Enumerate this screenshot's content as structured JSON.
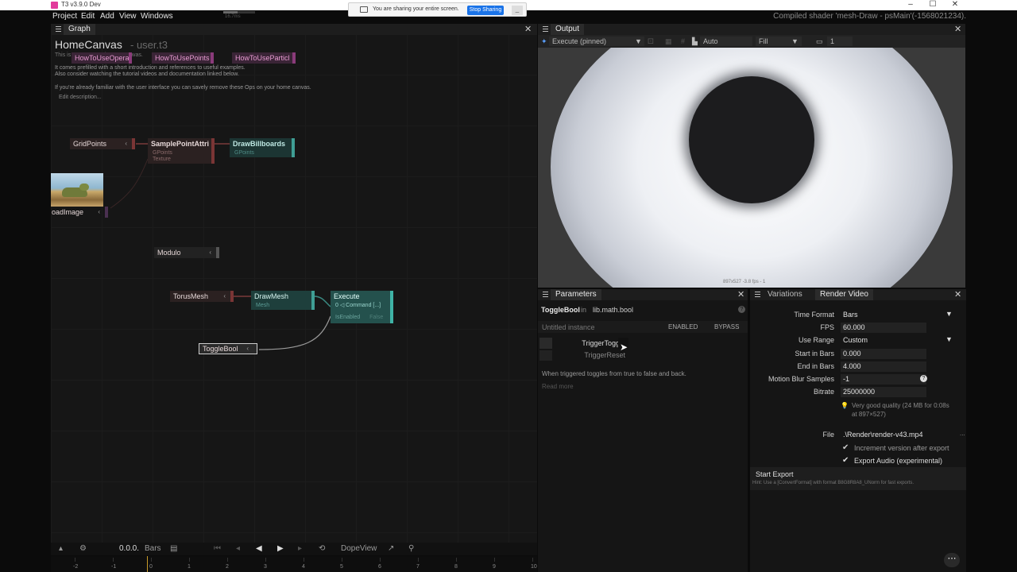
{
  "window": {
    "title": "T3 v3.9.0 Dev",
    "controls": [
      "–",
      "☐",
      "✕"
    ]
  },
  "menu": {
    "items": [
      "Project",
      "Edit",
      "Add",
      "View",
      "Windows"
    ],
    "perf_text": "16.7ms",
    "status": "Compiled shader 'mesh-Draw - psMain'(-1568021234)."
  },
  "share_banner": {
    "text": "You are sharing your entire screen.",
    "stop_label": "Stop Sharing",
    "minimize": "_"
  },
  "graph": {
    "tab": "Graph",
    "title": "HomeCanvas",
    "subtitle": "- user.t3",
    "intro_line": "This is your personal HomeCanvas.",
    "desc1": "It comes prefilled with a short introduction and references to useful examples.",
    "desc2": "Also consider watching the tutorial videos and documentation linked below.",
    "desc3": "If you're already familiar with the user interface you can savely remove these Ops on your home canvas.",
    "edit_description": "Edit description...",
    "howto": [
      "HowToUseOpera",
      "HowToUsePoints",
      "HowToUseParticl"
    ],
    "nodes": {
      "grid_points": "GridPoints",
      "sample_point_attri": "SamplePointAttri",
      "sample_slot1": "GPoints",
      "sample_slot2": "Texture",
      "draw_billboards": "DrawBillboards",
      "draw_billboards_slot": "GPoints",
      "load_image": "oadImage",
      "modulo": "Modulo",
      "torus_mesh": "TorusMesh",
      "draw_mesh": "DrawMesh",
      "draw_mesh_slot": "Mesh",
      "execute": "Execute",
      "execute_slot1": "0 ◁ Command [...]",
      "execute_slot2": "IsEnabled",
      "execute_slot2_val": "False",
      "toggle_bool": "ToggleBool"
    }
  },
  "timeline": {
    "time": "0.0.0.",
    "unit": "Bars",
    "mode": "DopeView",
    "ticks": [
      "-2",
      "-1",
      "0",
      "1",
      "2",
      "3",
      "4",
      "5",
      "6",
      "7",
      "8",
      "9",
      "10"
    ]
  },
  "output": {
    "tab": "Output",
    "execute": "Execute (pinned)",
    "res": "Auto",
    "fill": "Fill",
    "camera": "1",
    "footer": "897x527  -3.8 fps - 1"
  },
  "parameters": {
    "tab": "Parameters",
    "op_name": "ToggleBool",
    "in": "in",
    "namespace": "lib.math.bool",
    "instance": "Untitled instance",
    "enabled": "ENABLED",
    "bypass": "BYPASS",
    "p1": "TriggerToggle",
    "p2": "TriggerReset",
    "description": "When triggered toggles from true to false and back.",
    "read_more": "Read more"
  },
  "render": {
    "tab_variations": "Variations",
    "tab_render": "Render Video",
    "labels": {
      "time_format": "Time Format",
      "fps": "FPS",
      "use_range": "Use Range",
      "start": "Start in Bars",
      "end": "End in Bars",
      "motion": "Motion Blur Samples",
      "bitrate": "Bitrate",
      "file": "File"
    },
    "values": {
      "time_format": "Bars",
      "fps": "60.000",
      "use_range": "Custom",
      "start": "0.000",
      "end": "4.000",
      "motion": "-1",
      "bitrate": "25000000",
      "file": ".\\Render\\render-v43.mp4"
    },
    "quality1": "Very good quality (24 MB for 0:08s",
    "quality2": "at 897×527)",
    "increment": "Increment version after export",
    "export_audio": "Export Audio (experimental)",
    "start_export": "Start Export",
    "hint": "Hint: Use a [ConvertFormat] with format B8G8R8A8_UNorm for fast exports."
  }
}
